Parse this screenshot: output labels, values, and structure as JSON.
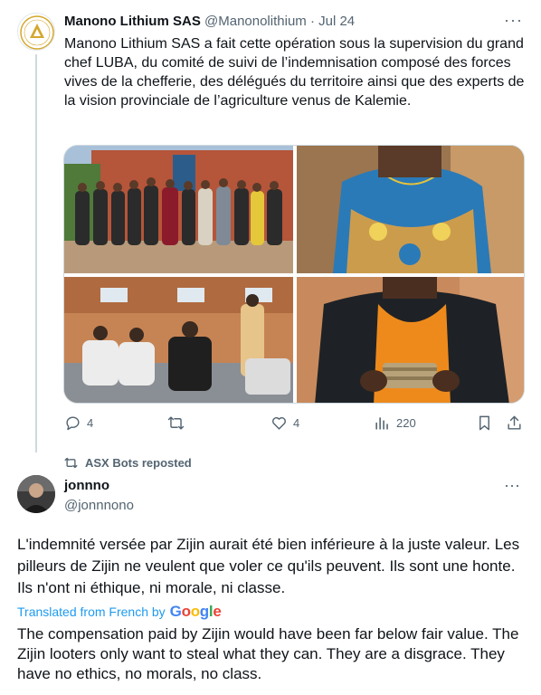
{
  "tweet1": {
    "display_name": "Manono Lithium SAS",
    "handle": "@Manonolithium",
    "separator": "·",
    "date": "Jul 24",
    "more_label": "···",
    "text": "Manono Lithium SAS a fait cette opération sous la supervision du grand chef LUBA, du comité de suivi de l’indemnisation composé des forces vives de la chefferie, des délégués du territoire ainsi que des experts de la vision provinciale de l’agriculture venus de Kalemie.",
    "photos": [
      "group-photo-outside-building",
      "woman-in-printed-dress",
      "meeting-room-people-seated",
      "man-holding-banknotes"
    ],
    "actions": {
      "replies": "4",
      "reposts": "",
      "likes": "4",
      "views": "220"
    }
  },
  "repost_banner": {
    "text": "ASX Bots reposted"
  },
  "tweet2": {
    "display_name": "jonnno",
    "handle": "@jonnnono",
    "more_label": "···",
    "text": "L'indemnité versée par Zijin aurait été bien inférieure à la juste valeur. Les pilleurs de Zijin ne veulent que voler ce qu'ils peuvent. Ils sont une honte. Ils n'ont ni éthique, ni morale, ni classe.",
    "translated_label": "Translated from French by",
    "google_label": "Google",
    "translation": "The compensation paid by Zijin would have been far below fair value. The Zijin looters only want to steal what they can. They are a disgrace. They have no ethics, no morals, no class."
  },
  "colors": {
    "text_primary": "#0f1419",
    "text_muted": "#536471",
    "link": "#1d9bf0",
    "border": "#cfd9de"
  }
}
